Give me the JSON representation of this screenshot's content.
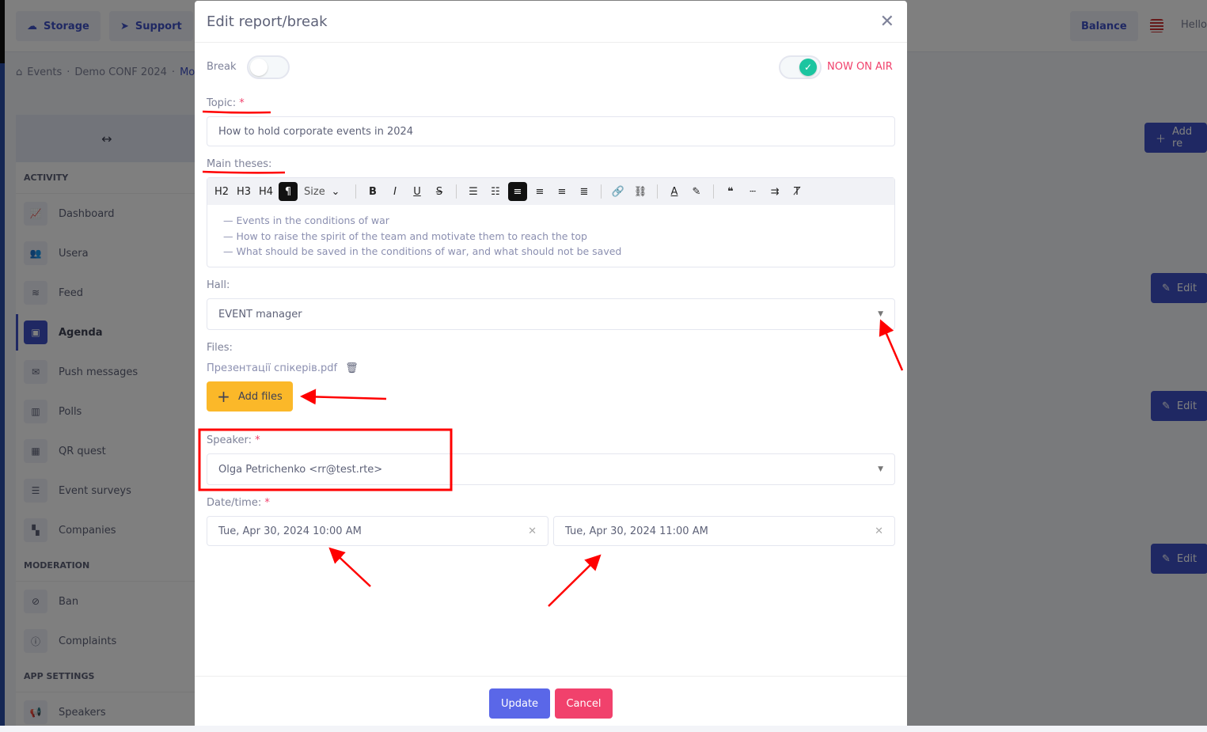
{
  "background": {
    "topbar": {
      "storage": "Storage",
      "support": "Support",
      "balance": "Balance",
      "greeting": "Hello,"
    },
    "breadcrumb": [
      "Events",
      "Demo CONF 2024",
      "Mo"
    ],
    "sidebar": {
      "toggle_icon": "↔",
      "sections": [
        {
          "title": "ACTIVITY",
          "items": [
            "Dashboard",
            "Usera",
            "Feed",
            "Agenda",
            "Push messages",
            "Polls",
            "QR quest",
            "Event surveys",
            "Companies"
          ]
        },
        {
          "title": "MODERATION",
          "items": [
            "Ban",
            "Complaints"
          ]
        },
        {
          "title": "APP SETTINGS",
          "items": [
            "Speakers"
          ]
        }
      ],
      "active": "Agenda"
    },
    "right_buttons": {
      "add": "Add re",
      "edit": "Edit"
    }
  },
  "modal": {
    "title": "Edit report/break",
    "break_label": "Break",
    "break_on": false,
    "on_air_label": "NOW ON AIR",
    "on_air_on": true,
    "topic_label": "Topic:",
    "topic_value": "How to hold corporate events in 2024",
    "theses_label": "Main theses:",
    "toolbar": [
      "H2",
      "H3",
      "H4",
      "¶",
      "Size",
      "B",
      "I",
      "U",
      "S"
    ],
    "theses_lines": [
      "— Events in the conditions of war",
      "— How to raise the spirit of the team and motivate them to reach the top",
      "— What should be saved in the conditions of war, and what should not be saved"
    ],
    "hall_label": "Hall:",
    "hall_value": "EVENT manager",
    "files_label": "Files:",
    "file_name": "Презентації спікерів.pdf",
    "add_files": "Add files",
    "speaker_label": "Speaker:",
    "speaker_value": "Olga Petrichenko <rr@test.rte>",
    "datetime_label": "Date/time:",
    "start": "Tue, Apr 30, 2024 10:00 AM",
    "end": "Tue, Apr 30, 2024 11:00 AM",
    "update": "Update",
    "cancel": "Cancel",
    "required_mark": "*"
  },
  "colors": {
    "primary": "#3f51c6",
    "accent_green": "#1bc5a0",
    "on_air": "#f1416c",
    "add_files": "#fbb829",
    "update": "#5a67e8",
    "cancel": "#f1416c",
    "annotation": "#ff0000"
  }
}
